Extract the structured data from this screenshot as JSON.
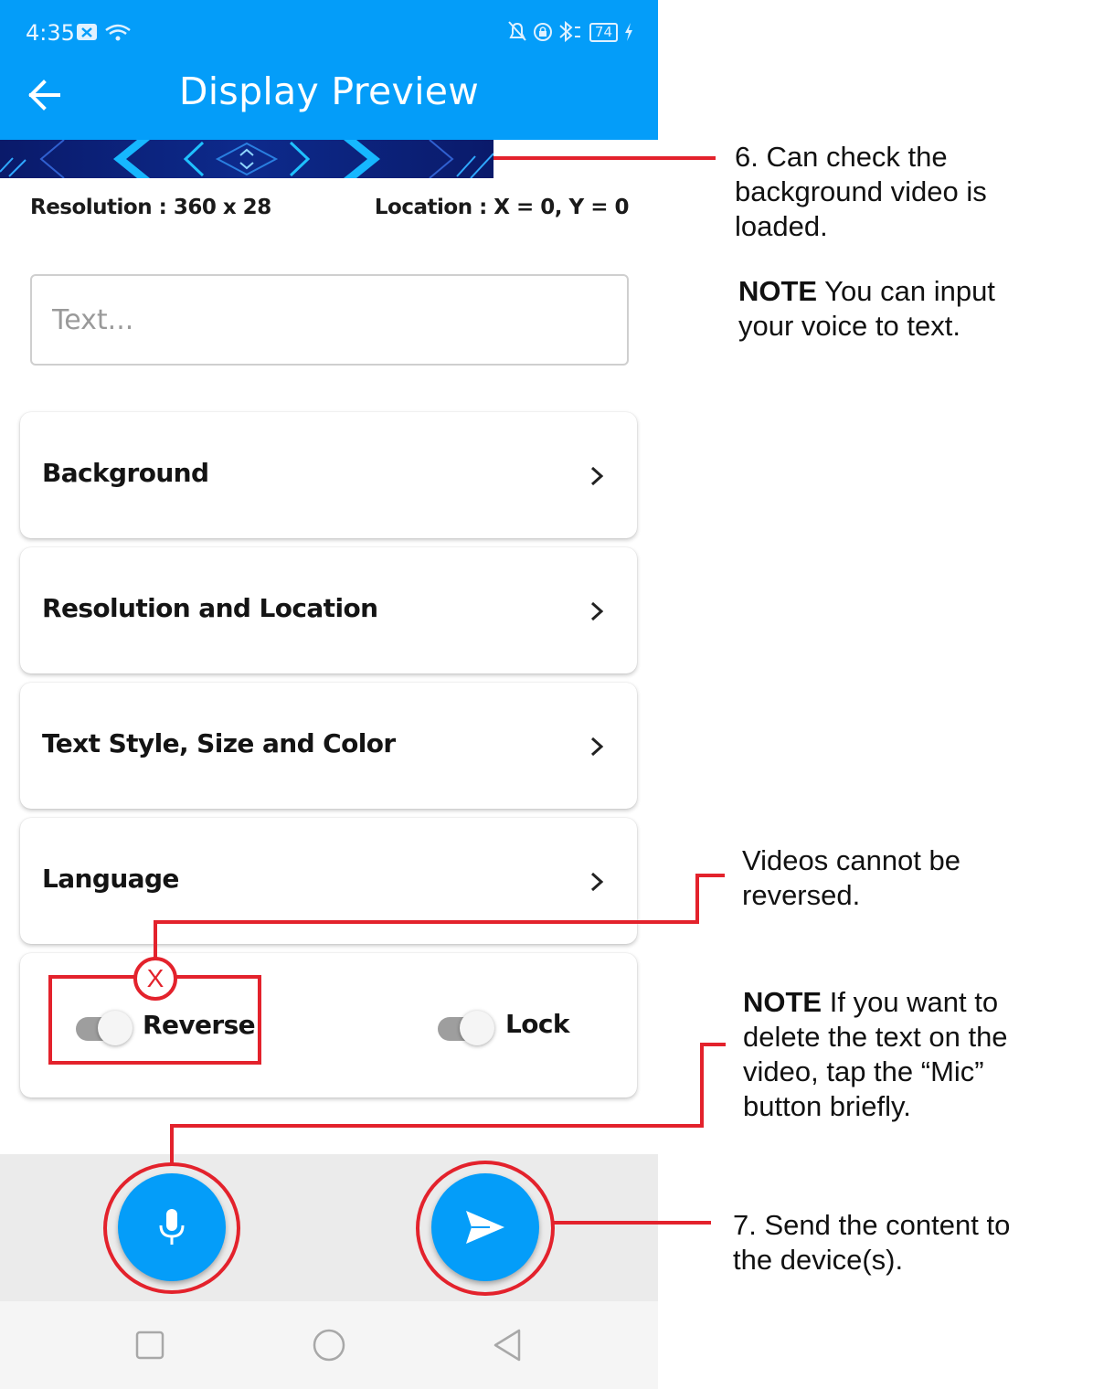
{
  "status_bar": {
    "time": "4:35",
    "battery": "74"
  },
  "app_bar": {
    "title": "Display Preview"
  },
  "info": {
    "resolution": "Resolution : 360 x 28",
    "location": "Location : X = 0, Y = 0"
  },
  "text_input": {
    "placeholder": "Text...",
    "value": ""
  },
  "menu": [
    {
      "label": "Background"
    },
    {
      "label": "Resolution and Location"
    },
    {
      "label": "Text Style, Size and Color"
    },
    {
      "label": "Language"
    }
  ],
  "toggles": {
    "reverse": {
      "label": "Reverse",
      "on": false
    },
    "lock": {
      "label": "Lock",
      "on": false
    }
  },
  "actions": {
    "mic": "mic-icon",
    "send": "send-icon"
  },
  "annotations": {
    "note6_main": "6. Can check the background video is loaded.",
    "note6_bold": "NOTE",
    "note6_text": " You can input your voice to text.",
    "reverse_note": "Videos cannot be reversed.",
    "x_mark": "X",
    "mic_bold": "NOTE",
    "mic_text": " If you want to delete the text on the video, tap the “Mic” button briefly.",
    "note7": "7. Send the content to the device(s)."
  },
  "colors": {
    "primary": "#049df9",
    "annotation_red": "#e3222c"
  }
}
